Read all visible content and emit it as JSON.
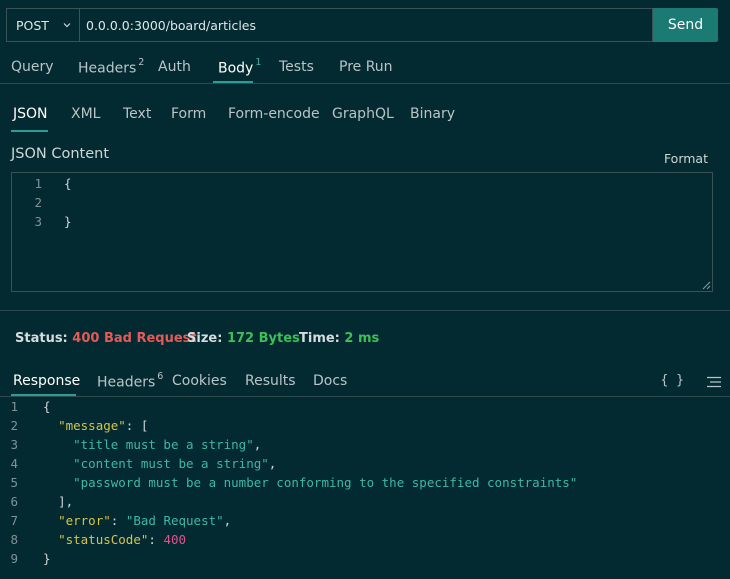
{
  "request": {
    "method": "POST",
    "url": "0.0.0.0:3000/board/articles",
    "send_label": "Send"
  },
  "request_tabs": [
    {
      "label": "Query",
      "badge": ""
    },
    {
      "label": "Headers",
      "badge": "2"
    },
    {
      "label": "Auth",
      "badge": ""
    },
    {
      "label": "Body",
      "badge": "1"
    },
    {
      "label": "Tests",
      "badge": ""
    },
    {
      "label": "Pre Run",
      "badge": ""
    }
  ],
  "body_tabs": [
    "JSON",
    "XML",
    "Text",
    "Form",
    "Form-encode",
    "GraphQL",
    "Binary"
  ],
  "body": {
    "label": "JSON Content",
    "format_label": "Format",
    "lines": [
      {
        "n": "1",
        "text": "{"
      },
      {
        "n": "2",
        "text": ""
      },
      {
        "n": "3",
        "text": "}"
      }
    ]
  },
  "status": {
    "status_label": "Status:",
    "status_value": "400 Bad Request",
    "size_label": "Size:",
    "size_value": "172 Bytes",
    "time_label": "Time:",
    "time_value": "2 ms"
  },
  "response_tabs": [
    {
      "label": "Response",
      "badge": ""
    },
    {
      "label": "Headers",
      "badge": "6"
    },
    {
      "label": "Cookies",
      "badge": ""
    },
    {
      "label": "Results",
      "badge": ""
    },
    {
      "label": "Docs",
      "badge": ""
    }
  ],
  "response_icons": {
    "braces": "{ }"
  },
  "response_lines": {
    "l1": {
      "n": "1",
      "open": "{"
    },
    "l2": {
      "n": "2",
      "key": "\"message\"",
      "rest": ": ["
    },
    "l3": {
      "n": "3",
      "str": "\"title must be a string\"",
      "rest": ","
    },
    "l4": {
      "n": "4",
      "str": "\"content must be a string\"",
      "rest": ","
    },
    "l5": {
      "n": "5",
      "str": "\"password must be a number conforming to the specified constraints\""
    },
    "l6": {
      "n": "6",
      "text": "],"
    },
    "l7": {
      "n": "7",
      "key": "\"error\"",
      "sep": ": ",
      "str": "\"Bad Request\"",
      "rest": ","
    },
    "l8": {
      "n": "8",
      "key": "\"statusCode\"",
      "sep": ": ",
      "num": "400"
    },
    "l9": {
      "n": "9",
      "close": "}"
    }
  }
}
